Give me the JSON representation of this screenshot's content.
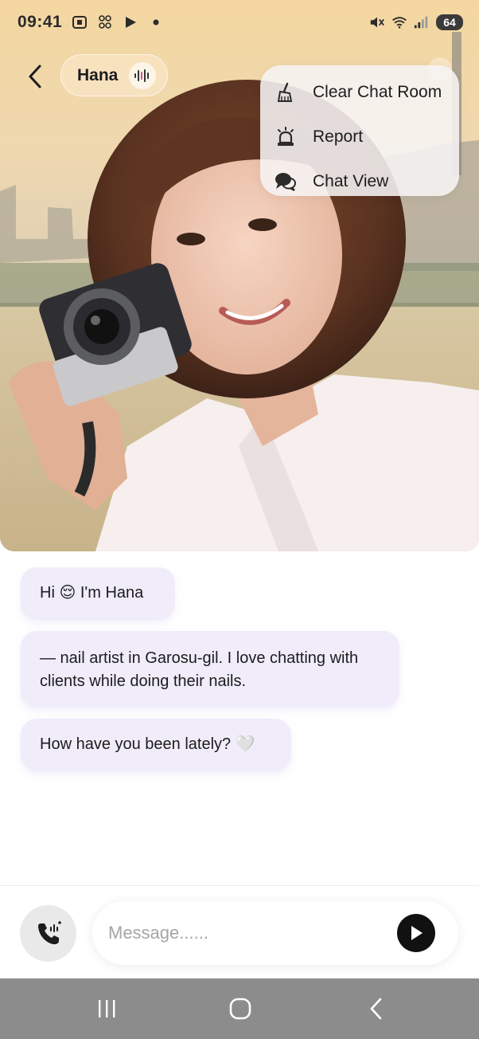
{
  "status_bar": {
    "time": "09:41",
    "battery": "64",
    "left_icons": [
      "screenshot-icon",
      "qr-icon",
      "play-store-icon",
      "dot-icon"
    ],
    "right_icons": [
      "mute-icon",
      "wifi-icon",
      "signal-icon",
      "battery-icon"
    ]
  },
  "header": {
    "name": "Hana",
    "voice_icon": "voice-waveform-icon"
  },
  "menu": {
    "items": [
      {
        "label": "Clear Chat Room",
        "icon": "broom-icon"
      },
      {
        "label": "Report",
        "icon": "siren-icon"
      },
      {
        "label": "Chat View",
        "icon": "chat-bubbles-icon"
      }
    ]
  },
  "messages": [
    {
      "text": "Hi 😌 I'm Hana"
    },
    {
      "text": "— nail artist in Garosu-gil. I love chatting with clients while doing their nails."
    },
    {
      "text": "How have you been lately? 🤍"
    }
  ],
  "composer": {
    "placeholder": "Message......",
    "call_icon": "phone-call-icon",
    "send_icon": "send-icon"
  },
  "colors": {
    "bubble": "#f0ecfa",
    "nav_bar": "#8c8c8c",
    "send_button": "#111111"
  }
}
